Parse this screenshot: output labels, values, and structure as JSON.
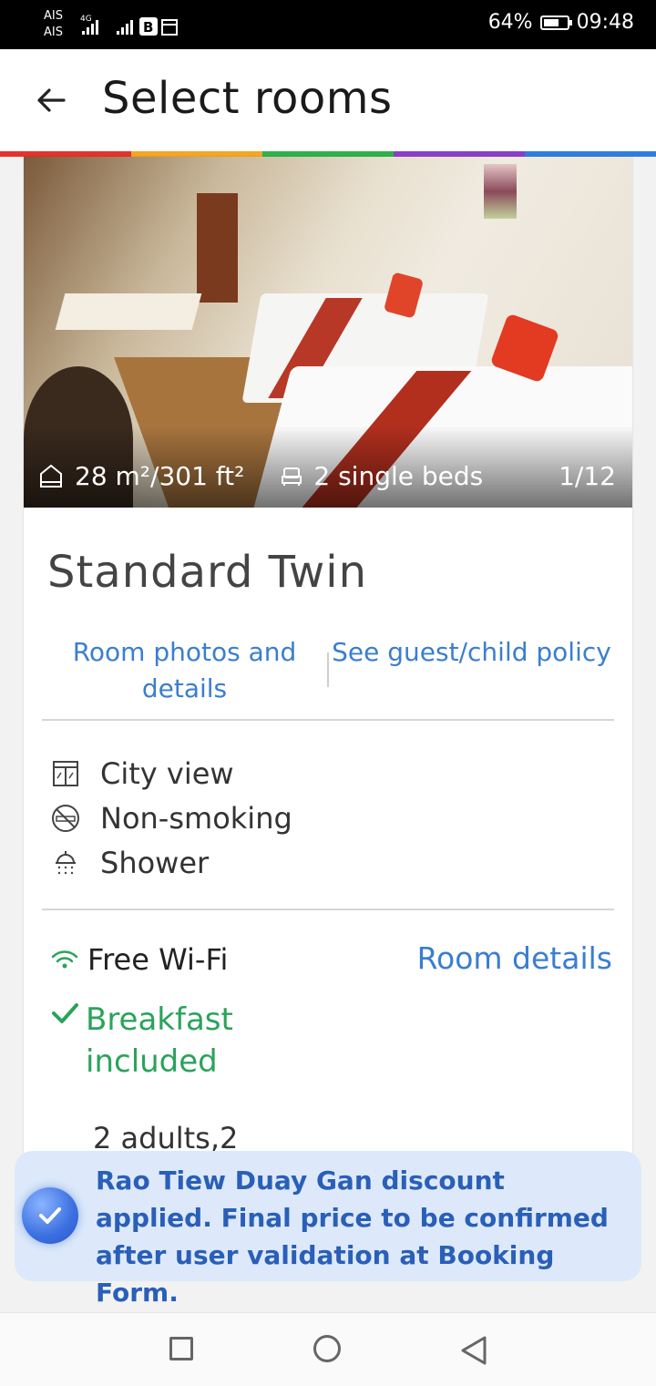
{
  "status_bar": {
    "carrier1": "AIS",
    "carrier2": "AIS",
    "network": "4G",
    "battery": "64%",
    "time": "09:48"
  },
  "header": {
    "title": "Select rooms",
    "rainbow_colors": [
      "#e8312b",
      "#f5a623",
      "#2db24a",
      "#8b3fc8",
      "#2f7de1"
    ]
  },
  "room": {
    "size": "28 m²/301 ft²",
    "beds": "2 single beds",
    "photo_counter": "1/12",
    "name": "Standard Twin",
    "links": {
      "photos": "Room photos and details",
      "policy": "See guest/child policy"
    },
    "features": [
      {
        "icon": "window-icon",
        "label": "City view"
      },
      {
        "icon": "no-smoking-icon",
        "label": "Non-smoking"
      },
      {
        "icon": "shower-icon",
        "label": "Shower"
      }
    ],
    "wifi": "Free Wi-Fi",
    "room_details": "Room details",
    "breakfast": "Breakfast included",
    "occupancy": "2 adults,2"
  },
  "banner": {
    "text": "Rao Tiew Duay Gan discount applied. Final price to be confirmed after user validation at Booking Form."
  },
  "colors": {
    "link": "#3a7ecf",
    "success": "#2aa35a",
    "banner_bg": "#dde9fb",
    "banner_text": "#2a5fb8"
  }
}
